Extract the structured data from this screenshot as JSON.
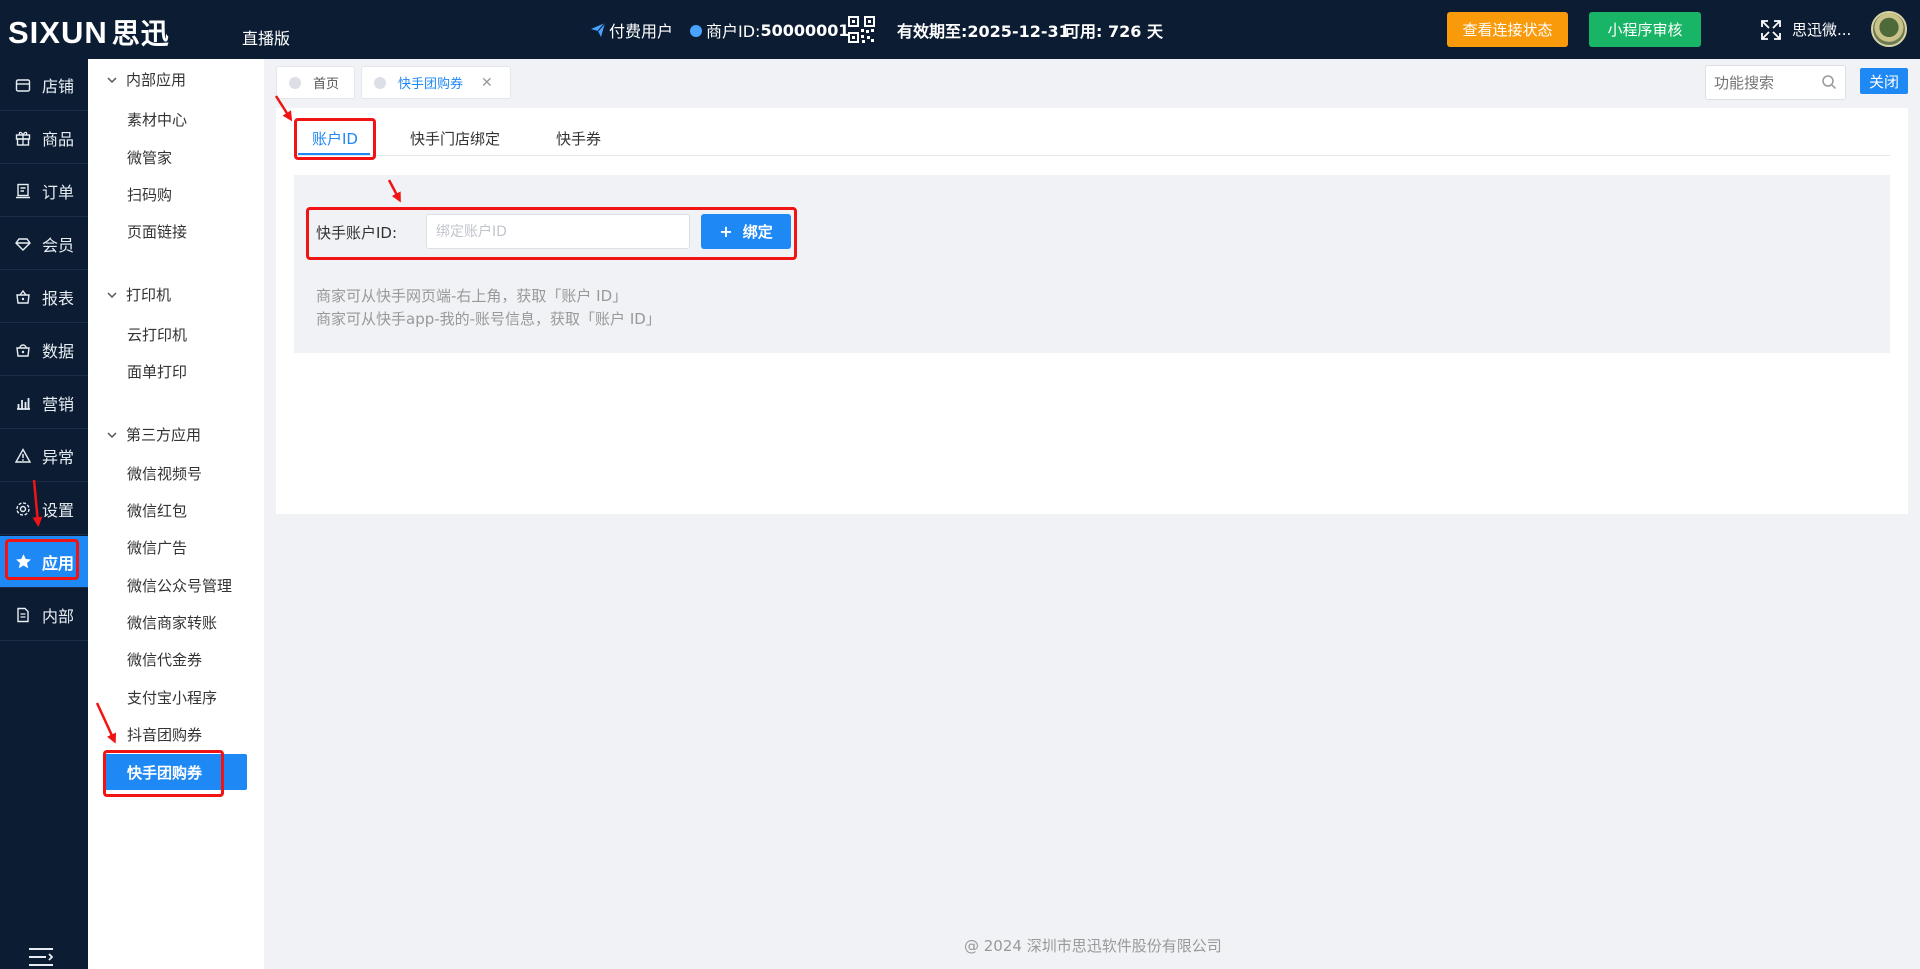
{
  "header": {
    "logo_text": "SIXUN",
    "logo_cn": "思迅",
    "edition": "直播版",
    "user_type": "付费用户",
    "merchant_label": "商户ID:",
    "merchant_id": "50000001",
    "expiry_label": "有效期至:",
    "expiry_date": "2025-12-31",
    "available_label": "可用:",
    "available_days": "726 天",
    "btn_connection": "查看连接状态",
    "btn_review": "小程序审核",
    "username": "思迅微..."
  },
  "leftnav": {
    "items": [
      {
        "label": "店铺",
        "icon": "store-icon"
      },
      {
        "label": "商品",
        "icon": "gift-icon"
      },
      {
        "label": "订单",
        "icon": "order-icon"
      },
      {
        "label": "会员",
        "icon": "diamond-icon"
      },
      {
        "label": "报表",
        "icon": "basket-icon"
      },
      {
        "label": "数据",
        "icon": "bag-icon"
      },
      {
        "label": "营销",
        "icon": "bar-chart-icon"
      },
      {
        "label": "异常",
        "icon": "warning-icon"
      },
      {
        "label": "设置",
        "icon": "gear-icon"
      },
      {
        "label": "应用",
        "icon": "star-icon"
      },
      {
        "label": "内部",
        "icon": "document-icon"
      }
    ],
    "active_index": 9
  },
  "subnav": {
    "groups": [
      {
        "title": "内部应用",
        "items": [
          "素材中心",
          "微管家",
          "扫码购",
          "页面链接"
        ]
      },
      {
        "title": "打印机",
        "items": [
          "云打印机",
          "面单打印"
        ]
      },
      {
        "title": "第三方应用",
        "items": [
          "微信视频号",
          "微信红包",
          "微信广告",
          "微信公众号管理",
          "微信商家转账",
          "微信代金券",
          "支付宝小程序",
          "抖音团购券",
          "快手团购券"
        ]
      }
    ],
    "active_item": "快手团购券"
  },
  "page_tabs": {
    "tabs": [
      {
        "label": "首页"
      },
      {
        "label": "快手团购券"
      }
    ],
    "active_index": 1,
    "search_placeholder": "功能搜索",
    "close_label": "关闭"
  },
  "main": {
    "tabs": [
      "账户ID",
      "快手门店绑定",
      "快手券"
    ],
    "active_tab": 0,
    "form": {
      "label": "快手账户ID:",
      "input_value": "",
      "input_placeholder": "绑定账户ID",
      "bind_button": "绑定"
    },
    "hints": [
      "商家可从快手网页端-右上角，获取「账户 ID」",
      "商家可从快手app-我的-账号信息，获取「账户 ID」"
    ]
  },
  "footer": {
    "copyright": "@ 2024 深圳市思迅软件股份有限公司"
  },
  "colors": {
    "header_bg": "#0c1d33",
    "accent": "#1e88f5",
    "orange": "#f99a0a",
    "green": "#18b566",
    "annotation_red": "#f01414"
  }
}
